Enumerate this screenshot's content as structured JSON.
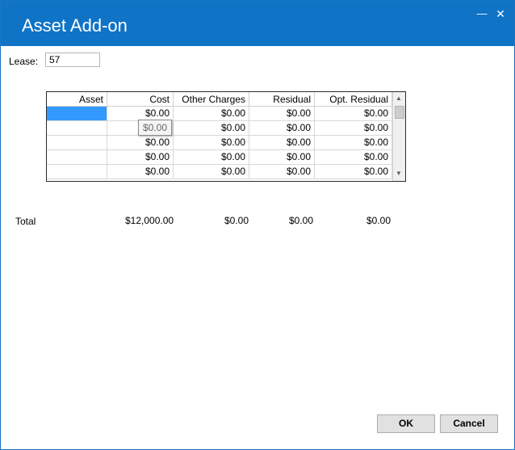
{
  "window": {
    "title": "Asset Add-on",
    "minimize_glyph": "—",
    "close_glyph": "✕"
  },
  "lease": {
    "label": "Lease:",
    "value": "57"
  },
  "grid": {
    "columns": [
      "Asset",
      "Cost",
      "Other Charges",
      "Residual",
      "Opt. Residual"
    ],
    "rows": [
      {
        "asset": "",
        "cost": "$0.00",
        "other": "$0.00",
        "residual": "$0.00",
        "opt": "$0.00"
      },
      {
        "asset": "",
        "cost": "",
        "other": "$0.00",
        "residual": "$0.00",
        "opt": "$0.00"
      },
      {
        "asset": "",
        "cost": "$0.00",
        "other": "$0.00",
        "residual": "$0.00",
        "opt": "$0.00"
      },
      {
        "asset": "",
        "cost": "$0.00",
        "other": "$0.00",
        "residual": "$0.00",
        "opt": "$0.00"
      },
      {
        "asset": "",
        "cost": "$0.00",
        "other": "$0.00",
        "residual": "$0.00",
        "opt": "$0.00"
      }
    ],
    "tooltip": "$0.00",
    "scroll_up_glyph": "▲",
    "scroll_down_glyph": "▼",
    "selection_color": "#3399ff"
  },
  "totals": {
    "label": "Total",
    "cost": "$12,000.00",
    "other": "$0.00",
    "residual": "$0.00",
    "opt": "$0.00"
  },
  "buttons": {
    "ok": "OK",
    "cancel": "Cancel"
  },
  "colors": {
    "titlebar": "#0f73c6"
  }
}
